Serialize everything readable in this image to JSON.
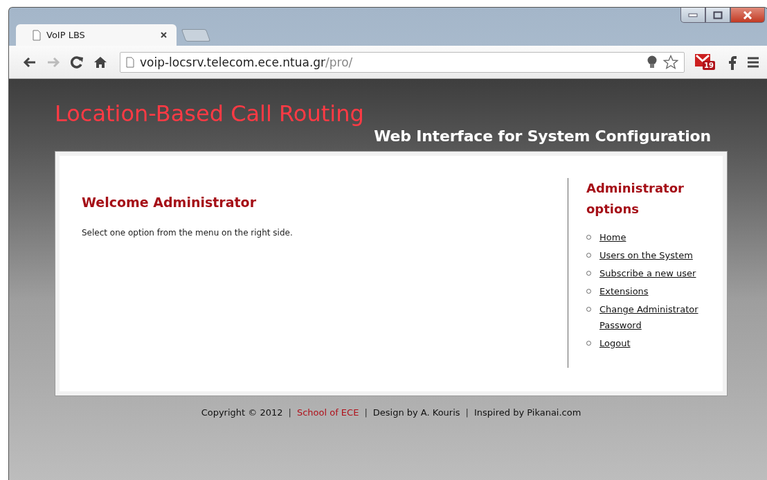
{
  "browser": {
    "tabs": [
      {
        "title": "VoIP LBS",
        "selected": true
      }
    ],
    "address": {
      "host": "voip-locsrv.telecom.ece.ntua.gr",
      "path": "/pro/"
    },
    "mail_badge": "19"
  },
  "header": {
    "title": "Location-Based Call Routing",
    "subtitle": "Web Interface for System Configuration"
  },
  "main": {
    "heading": "Welcome Administrator",
    "text": "Select one option from the menu on the right side."
  },
  "sidebar": {
    "heading": "Administrator options",
    "items": [
      {
        "label": "Home"
      },
      {
        "label": "Users on the System"
      },
      {
        "label": "Subscribe a new user"
      },
      {
        "label": "Extensions"
      },
      {
        "label": "Change Administrator Password"
      },
      {
        "label": "Logout"
      }
    ]
  },
  "footer": {
    "items": [
      {
        "kind": "text",
        "text": "Copyright © 2012"
      },
      {
        "kind": "sep",
        "text": "|"
      },
      {
        "kind": "link",
        "text": "School of ECE"
      },
      {
        "kind": "sep",
        "text": "|"
      },
      {
        "kind": "text",
        "text": "Design by A. Kouris"
      },
      {
        "kind": "sep",
        "text": "|"
      },
      {
        "kind": "text",
        "text": "Inspired by Pikanai.com"
      }
    ]
  }
}
